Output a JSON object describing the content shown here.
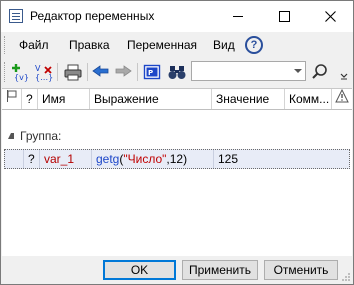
{
  "window": {
    "title": "Редактор переменных"
  },
  "menu": {
    "items": [
      "Файл",
      "Правка",
      "Переменная",
      "Вид"
    ]
  },
  "toolbar": {
    "search_value": ""
  },
  "table": {
    "headers": [
      "?",
      "Имя",
      "Выражение",
      "Значение",
      "Комм..."
    ],
    "group_label": "Группа:",
    "rows": [
      {
        "flag": "?",
        "name": "var_1",
        "expr_func": "getg",
        "expr_open": "(",
        "expr_str": "\"Число\"",
        "expr_comma": ",",
        "expr_num": "12",
        "expr_close": ")",
        "value": "125",
        "comment": ""
      }
    ]
  },
  "buttons": {
    "ok": "OK",
    "apply": "Применить",
    "cancel": "Отменить"
  },
  "colors": {
    "accent": "#2a4f9c",
    "row_selected": "#e8ecf7",
    "name_red": "#b40000",
    "func_blue": "#1c46c8",
    "string_red": "#c00000"
  }
}
